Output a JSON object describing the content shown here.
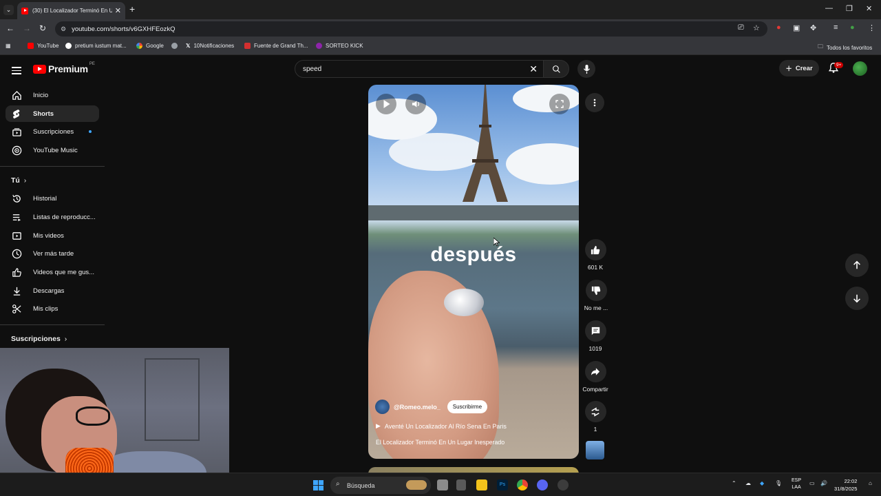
{
  "browser": {
    "tab_title": "(30) El Localizador Terminó En U",
    "url": "youtube.com/shorts/v6GXHFEozkQ",
    "bookmarks": [
      "YouTube",
      "pretium iustum mat...",
      "Google",
      "",
      "10Notificaciones",
      "Fuente de Grand Th...",
      "SORTEO KICK"
    ],
    "all_bookmarks": "Todos los favoritos"
  },
  "youtube": {
    "logo_text": "Premium",
    "logo_region": "PE",
    "search_value": "speed",
    "create_label": "Crear",
    "notifications_badge": "9+",
    "sidebar": {
      "main": [
        {
          "label": "Inicio",
          "icon": "home-icon"
        },
        {
          "label": "Shorts",
          "icon": "shorts-icon"
        },
        {
          "label": "Suscripciones",
          "icon": "subscriptions-icon"
        },
        {
          "label": "YouTube Music",
          "icon": "music-icon"
        }
      ],
      "you_header": "Tú",
      "you": [
        {
          "label": "Historial",
          "icon": "history-icon"
        },
        {
          "label": "Listas de reproducc...",
          "icon": "playlists-icon"
        },
        {
          "label": "Mis videos",
          "icon": "my-videos-icon"
        },
        {
          "label": "Ver más tarde",
          "icon": "watch-later-icon"
        },
        {
          "label": "Videos que me gus...",
          "icon": "liked-icon"
        },
        {
          "label": "Descargas",
          "icon": "download-icon"
        },
        {
          "label": "Mis clips",
          "icon": "clips-icon"
        }
      ],
      "subs_header": "Suscripciones"
    },
    "short": {
      "caption": "después",
      "channel": "@Romeo.melo_",
      "subscribe_label": "Suscribirme",
      "title": "Aventé Un Localizador Al Río Sena En Paris",
      "description": "El Localizador Terminó En Un Lugar Inesperado"
    },
    "actions": {
      "likes": "601 K",
      "dislike_label": "No me ...",
      "comments": "1019",
      "share_label": "Compartir",
      "remix_count": "1"
    }
  },
  "taskbar": {
    "search_placeholder": "Búsqueda",
    "lang_top": "ESP",
    "lang_bottom": "LAA",
    "time": "22:02",
    "date": "31/8/2025"
  }
}
